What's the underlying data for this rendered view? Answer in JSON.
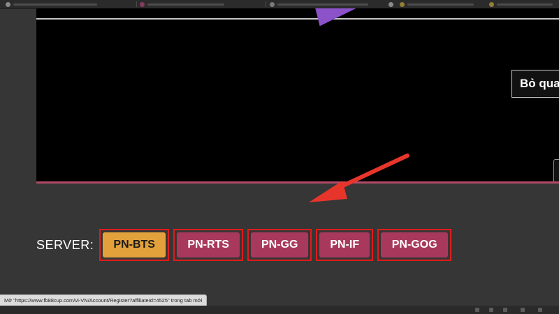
{
  "browser": {
    "tabs": [
      {
        "favicon": "site-favicon",
        "color": "#d8d8d8"
      },
      {
        "favicon": "site-favicon",
        "color": "#d3488a"
      },
      {
        "favicon": "site-favicon",
        "color": "#bcbcbc"
      },
      {
        "favicon": "site-favicon",
        "color": "#d8d8d8"
      },
      {
        "favicon": "smiley-favicon",
        "color": "#e6c53a"
      },
      {
        "favicon": "smiley-favicon",
        "color": "#e6c53a"
      }
    ],
    "status_url": "Mở \"https://www.fb88cup.com/vi-VN/Account/Register?affiliateId=4525\" trong tab mới"
  },
  "player": {
    "skip_label": "Bỏ qua",
    "play_icon": "play-triangle-icon",
    "accent_color": "#8b52c9"
  },
  "annotation": {
    "arrow_icon": "red-arrow-icon",
    "color": "#e8352b"
  },
  "server": {
    "label": "SERVER:",
    "buttons": [
      {
        "label": "PN-BTS",
        "active": true
      },
      {
        "label": "PN-RTS",
        "active": false
      },
      {
        "label": "PN-GG",
        "active": false
      },
      {
        "label": "PN-IF",
        "active": false
      },
      {
        "label": "PN-GOG",
        "active": false
      }
    ],
    "colors": {
      "active": "#e3a13c",
      "inactive": "#a9395c",
      "outline": "#e11b1b"
    }
  }
}
